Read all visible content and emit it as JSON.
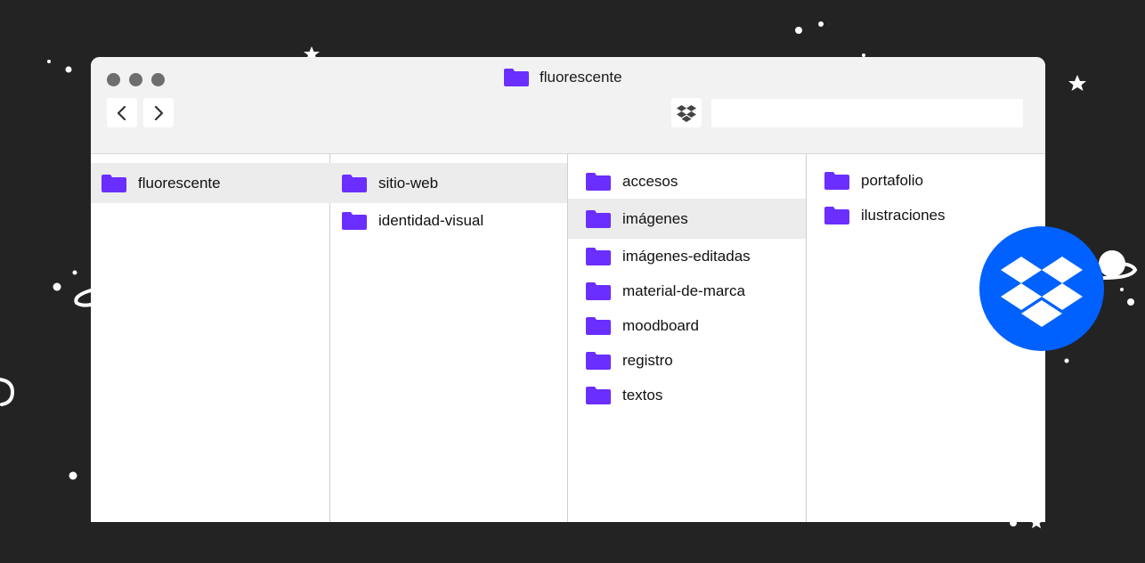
{
  "colors": {
    "background": "#232323",
    "folder": "#6a2eff",
    "window": "#ffffff",
    "titlebar": "#f2f2f2",
    "selection": "#ececec",
    "dropbox_blue": "#0061fe"
  },
  "window": {
    "title": "fluorescente",
    "icons": {
      "back": "chevron-left-icon",
      "forward": "chevron-right-icon",
      "dropbox": "dropbox-icon",
      "folder": "folder-icon"
    },
    "search": {
      "value": "",
      "placeholder": ""
    }
  },
  "columns": [
    {
      "items": [
        {
          "label": "fluorescente",
          "selected": true
        }
      ]
    },
    {
      "items": [
        {
          "label": "sitio-web",
          "selected": true
        },
        {
          "label": "identidad-visual",
          "selected": false
        }
      ]
    },
    {
      "items": [
        {
          "label": "accesos",
          "selected": false
        },
        {
          "label": "imágenes",
          "selected": true
        },
        {
          "label": "imágenes-editadas",
          "selected": false
        },
        {
          "label": "material-de-marca",
          "selected": false
        },
        {
          "label": "moodboard",
          "selected": false
        },
        {
          "label": "registro",
          "selected": false
        },
        {
          "label": "textos",
          "selected": false
        }
      ]
    },
    {
      "items": [
        {
          "label": "portafolio",
          "selected": false
        },
        {
          "label": "ilustraciones",
          "selected": false
        }
      ]
    }
  ]
}
